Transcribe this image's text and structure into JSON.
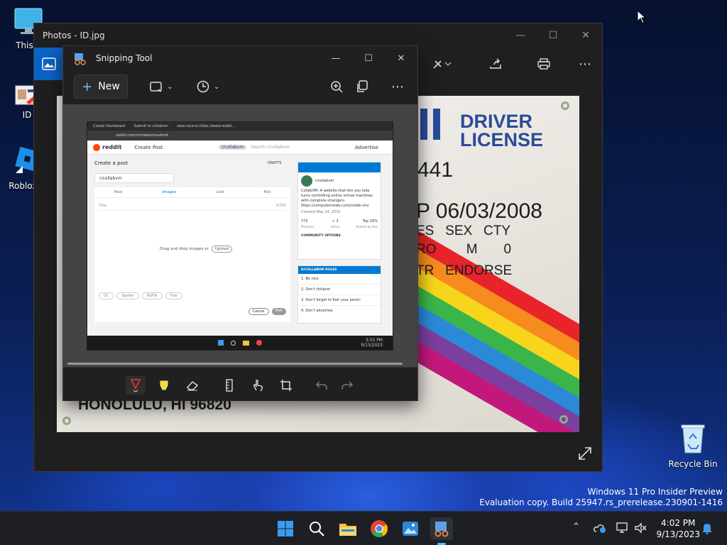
{
  "desktop": {
    "icons": [
      {
        "label": "This P"
      },
      {
        "label": "ID"
      },
      {
        "label": "Roblox S"
      },
      {
        "label": "Recycle Bin"
      }
    ],
    "watermark_line1": "Windows 11 Pro Insider Preview",
    "watermark_line2": "Evaluation copy. Build 25947.rs_prerelease.230901-1416"
  },
  "photos": {
    "title": "Photos - ID.jpg",
    "license": {
      "header1": "DRIVER",
      "header2": "LICENSE",
      "number": "441",
      "exp": "P 06/03/2008",
      "row1": "ES   SEX   CTY",
      "row2": "RO        M       0",
      "row3": "TR   ENDORSE",
      "address": "HONOLULU, HI 96820"
    }
  },
  "snipping": {
    "title": "Snipping Tool",
    "new_label": "New",
    "captured": {
      "tab1": "Create Dashboard",
      "tab2": "Submit to collabvm",
      "tab3": "view-source:https://www.reddit...",
      "url": "reddit.com/r/collabvm/submit",
      "brand": "reddit",
      "create_post": "Create Post",
      "search": "r/collabvm",
      "search_placeholder": "Search r/collabvm",
      "advertise": "Advertise",
      "heading": "Create a post",
      "drafts": "DRAFTS",
      "community": "r/collabvm",
      "tabs": [
        "Post",
        "Images",
        "Link",
        "Poll"
      ],
      "title_placeholder": "Title",
      "counter": "0/300",
      "drop": "Drag and drop images or",
      "upload": "Upload",
      "chips": [
        "OC",
        "Spoiler",
        "NSFW",
        "Flair"
      ],
      "cancel": "Cancel",
      "post": "Post",
      "side_name": "r/collabvm",
      "side_desc": "CollabVM: A website that lets you take turns controlling online virtual machines with complete strangers. https://computernewb.com/collab-vm/",
      "created": "Created May 24, 2015",
      "stats": [
        "775",
        "≈ 3",
        "Top 20%"
      ],
      "stats_labels": [
        "Members",
        "Online",
        "Ranked by Size"
      ],
      "community_options": "COMMUNITY OPTIONS",
      "rules_title": "R/COLLABVM RULES",
      "rules": [
        "1. Be nice",
        "2. Don't shitpost",
        "3. Don't forget to flair your posts!",
        "4. Don't advertise"
      ],
      "mini_time": "3:55 PM",
      "mini_date": "9/13/2023"
    }
  },
  "taskbar": {
    "time": "4:02 PM",
    "date": "9/13/2023"
  }
}
